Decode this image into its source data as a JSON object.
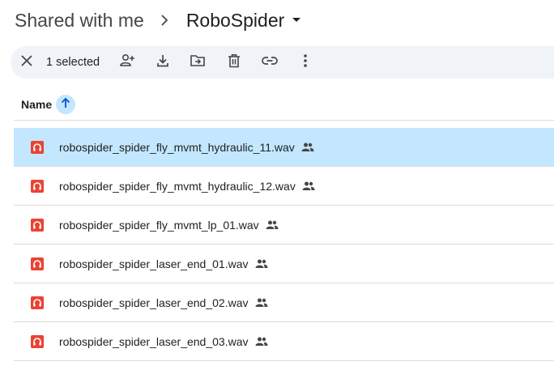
{
  "breadcrumb": {
    "parent": "Shared with me",
    "current": "RoboSpider"
  },
  "toolbar": {
    "selected_count": "1 selected",
    "icons": [
      "close-icon",
      "share-add-person-icon",
      "download-icon",
      "move-to-folder-icon",
      "delete-icon",
      "copy-link-icon",
      "more-vert-icon"
    ]
  },
  "list_header": {
    "name_label": "Name",
    "sort_direction": "ascending"
  },
  "files": [
    {
      "name": "robospider_spider_fly_mvmt_hydraulic_11.wav",
      "selected": true
    },
    {
      "name": "robospider_spider_fly_mvmt_hydraulic_12.wav",
      "selected": false
    },
    {
      "name": "robospider_spider_fly_mvmt_lp_01.wav",
      "selected": false
    },
    {
      "name": "robospider_spider_laser_end_01.wav",
      "selected": false
    },
    {
      "name": "robospider_spider_laser_end_02.wav",
      "selected": false
    },
    {
      "name": "robospider_spider_laser_end_03.wav",
      "selected": false
    }
  ],
  "colors": {
    "toolbar_bg": "#f0f4f9",
    "selected_row": "#c2e7ff",
    "audio_icon": "#ea4335",
    "divider": "#dadce0"
  }
}
